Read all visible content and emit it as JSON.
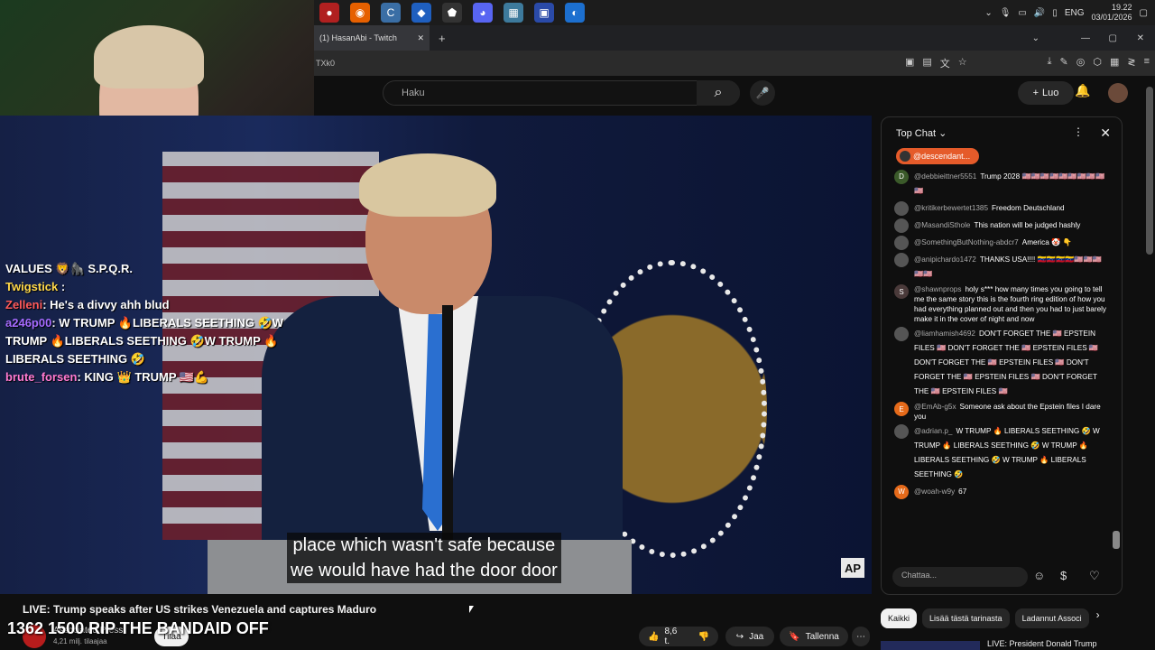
{
  "taskbar": {
    "apps": [
      "stream-app-icon",
      "firefox-icon",
      "ccleaner-icon",
      "app-icon",
      "shield-app-icon",
      "discord-icon",
      "files-icon",
      "monitor-app-icon",
      "edge-icon"
    ],
    "lang": "ENG",
    "time": "19.22",
    "date": "03/01/2026"
  },
  "browser": {
    "tab_title": "(1) HasanAbi - Twitch",
    "address": "TXk0"
  },
  "youtube": {
    "search_placeholder": "Haku",
    "create_label": "Luo",
    "video_title": "LIVE: Trump speaks after US strikes Venezuela and captures Maduro",
    "channel_name": "Associated Press",
    "subscribers": "4,21 milj. tilaajaa",
    "subscribe_label": "Tilaa",
    "likes": "8,6 t.",
    "share_label": "Jaa",
    "save_label": "Tallenna",
    "subtitle_lines": [
      "place which wasn't safe because",
      "we would have had the door door"
    ],
    "watermark": "AP"
  },
  "overlay_chat": {
    "lines": [
      {
        "user": "",
        "text": "VALUES 🦁🦍 S.P.Q.R."
      },
      {
        "user": "Twigstick",
        "text": ":"
      },
      {
        "user": "Zelleni",
        "text": "He's a divvy ahh blud"
      },
      {
        "user": "a246p00",
        "text": "W TRUMP 🔥LIBERALS SEETHING 🤣W TRUMP 🔥LIBERALS SEETHING 🤣W TRUMP 🔥LIBERALS SEETHING 🤣"
      },
      {
        "user": "brute_forsen",
        "text": "KING 👑 TRUMP 🇺🇸💪"
      }
    ],
    "stream_banner": "1362 1500 RIP THE BANDAID OFF"
  },
  "chat": {
    "mode": "Top Chat",
    "pinned_user": "@descendant...",
    "messages": [
      {
        "avatar": "D",
        "author": "@debbieittner5551",
        "text": "Trump 2028 🇺🇸🇺🇸🇺🇸🇺🇸🇺🇸🇺🇸🇺🇸🇺🇸🇺🇸🇺🇸"
      },
      {
        "avatar": "",
        "author": "@kritikerbewertet1385",
        "text": "Freedom Deutschland"
      },
      {
        "avatar": "",
        "author": "@MasandiSthole",
        "text": "This nation will be judged hashly"
      },
      {
        "avatar": "",
        "author": "@SomethingButNothing-abdcr7",
        "text": "America 🤡 👇"
      },
      {
        "avatar": "",
        "author": "@anipichardo1472",
        "text": "THANKS USA!!!! 🇻🇪🇻🇪🇻🇪🇻🇪🇺🇸🇺🇸🇺🇸🇺🇸🇺🇸"
      },
      {
        "avatar": "S",
        "author": "@shawnprops",
        "text": "holy s*** how many times you going to tell me the same story this is the fourth ring edition of how you had everything planned out and then you had to just barely make it in the cover of night and now"
      },
      {
        "avatar": "",
        "author": "@liamhamish4692",
        "text": "DON'T FORGET THE 🇺🇸 EPSTEIN FILES 🇺🇸 DON'T FORGET THE 🇺🇸 EPSTEIN FILES 🇺🇸 DON'T FORGET THE 🇺🇸 EPSTEIN FILES 🇺🇸 DON'T FORGET THE 🇺🇸 EPSTEIN FILES 🇺🇸 DON'T FORGET THE 🇺🇸 EPSTEIN FILES 🇺🇸"
      },
      {
        "avatar": "E",
        "author": "@EmAb-g5x",
        "text": "Someone ask about the Epstein files I dare you"
      },
      {
        "avatar": "",
        "author": "@adrian.p_",
        "text": "W TRUMP 🔥 LIBERALS SEETHING 🤣 W TRUMP 🔥 LIBERALS SEETHING 🤣 W TRUMP 🔥 LIBERALS SEETHING 🤣 W TRUMP 🔥 LIBERALS SEETHING 🤣"
      },
      {
        "avatar": "W",
        "author": "@woah-w9y",
        "text": "67"
      }
    ],
    "input_placeholder": "Chattaa..."
  },
  "chips": [
    "Kaikki",
    "Lisää tästä tarinasta",
    "Ladannut Associ"
  ],
  "related_title": "LIVE: President Donald Trump",
  "colors": {
    "accent": "#e55b2a",
    "background": "#0f0f0f"
  }
}
